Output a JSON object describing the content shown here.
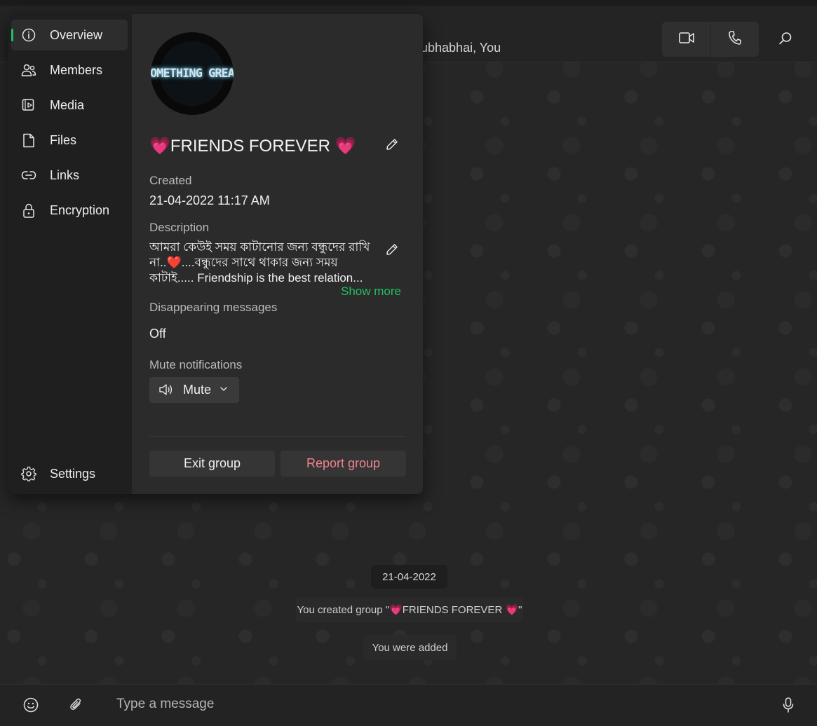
{
  "header": {
    "members": "ubhabhai, You",
    "video_call_icon": "video-call-icon",
    "voice_call_icon": "phone-icon",
    "search_icon": "search-icon"
  },
  "sidebar": {
    "items": [
      {
        "label": "Overview",
        "icon": "info-icon",
        "active": true
      },
      {
        "label": "Members",
        "icon": "members-icon"
      },
      {
        "label": "Media",
        "icon": "media-icon"
      },
      {
        "label": "Files",
        "icon": "file-icon"
      },
      {
        "label": "Links",
        "icon": "link-icon"
      },
      {
        "label": "Encryption",
        "icon": "lock-icon"
      }
    ],
    "settings_label": "Settings"
  },
  "group": {
    "avatar_text": "SOMETHING GREAT",
    "name": "💗FRIENDS FOREVER 💗",
    "created_label": "Created",
    "created_value": "21-04-2022 11:17 AM",
    "description_label": "Description",
    "description": "আমরা কেউই সময় কাটানোর জন্য বন্ধুদের রাখি না..❤️....বন্ধুদের সাথে থাকার জন্য সময় কাটাই.....   Friendship is the best relation...",
    "show_more": "Show more",
    "disappearing_label": "Disappearing messages",
    "disappearing_value": "Off",
    "mute_label": "Mute notifications",
    "mute_button": "Mute",
    "exit_button": "Exit group",
    "report_button": "Report group"
  },
  "chat": {
    "date": "21-04-2022",
    "system_messages": [
      "You created group \"💗FRIENDS FOREVER 💗\"",
      "You were added"
    ]
  },
  "composer": {
    "placeholder": "Type a message",
    "emoji_icon": "emoji-icon",
    "attach_icon": "paperclip-icon",
    "mic_icon": "microphone-icon"
  },
  "colors": {
    "accent": "#21c063",
    "danger": "#f1848f",
    "panel_bg": "#2b2b2b",
    "sidebar_bg": "#1f1f1f"
  }
}
